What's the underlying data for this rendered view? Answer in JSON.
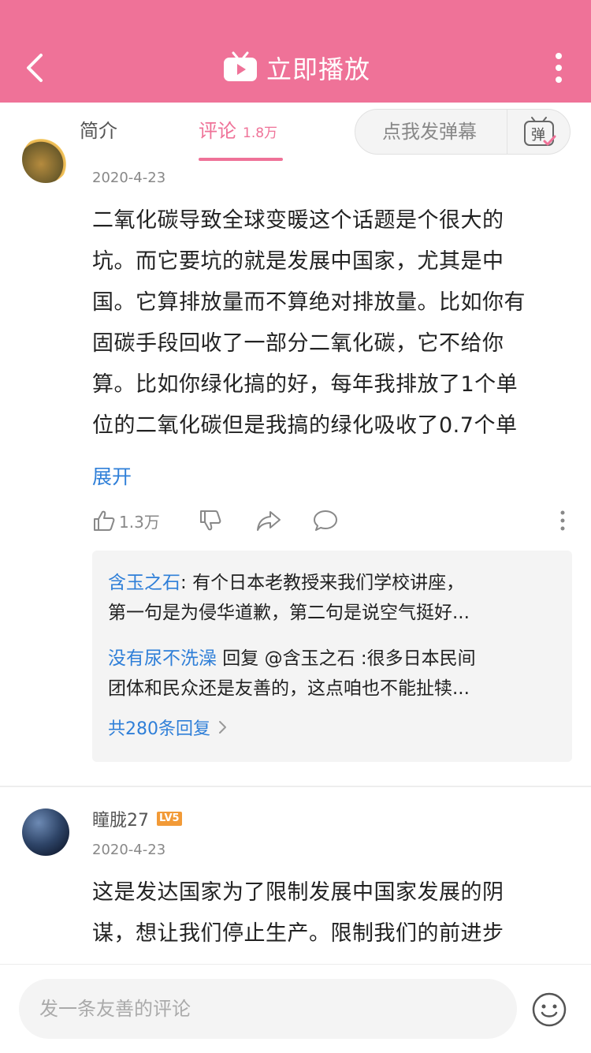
{
  "header": {
    "title": "立即播放"
  },
  "tabs": {
    "intro_label": "简介",
    "comments_label": "评论",
    "comments_count": "1.8万",
    "danmaku_placeholder": "点我发弹幕",
    "danmaku_icon_char": "弹"
  },
  "comment1": {
    "date": "2020-4-23",
    "lines": [
      "二氧化碳导致全球变暖这个话题是个很大的",
      "坑。而它要坑的就是发展中国家，尤其是中",
      "国。它算排放量而不算绝对排放量。比如你有",
      "固碳手段回收了一部分二氧化碳，它不给你",
      "算。比如你绿化搞的好，每年我排放了1个单",
      "位的二氧化碳但是我搞的绿化吸收了0.7个单"
    ],
    "expand_label": "展开",
    "like_count": "1.3万",
    "replies": [
      {
        "user": "含玉之石",
        "sep": ": ",
        "line1": "有个日本老教授来我们学校讲座，",
        "line2": "第一句是为侵华道歉，第二句是说空气挺好..."
      },
      {
        "user": "没有尿不洗澡",
        "middle": " 回复 @含玉之石 :很多日本民间",
        "line2": "团体和民众还是友善的，这点咱也不能扯犊..."
      }
    ],
    "reply_total_label": "共280条回复"
  },
  "comment2": {
    "username": "瞳胧27",
    "level": "LV5",
    "date": "2020-4-23",
    "lines": [
      "这是发达国家为了限制发展中国家发展的阴",
      "谋，想让我们停止生产。限制我们的前进步"
    ]
  },
  "bottom": {
    "input_placeholder": "发一条友善的评论"
  },
  "colors": {
    "brand_pink": "#ef7298",
    "link_blue": "#2f7fd8",
    "level_orange": "#f29a37"
  }
}
